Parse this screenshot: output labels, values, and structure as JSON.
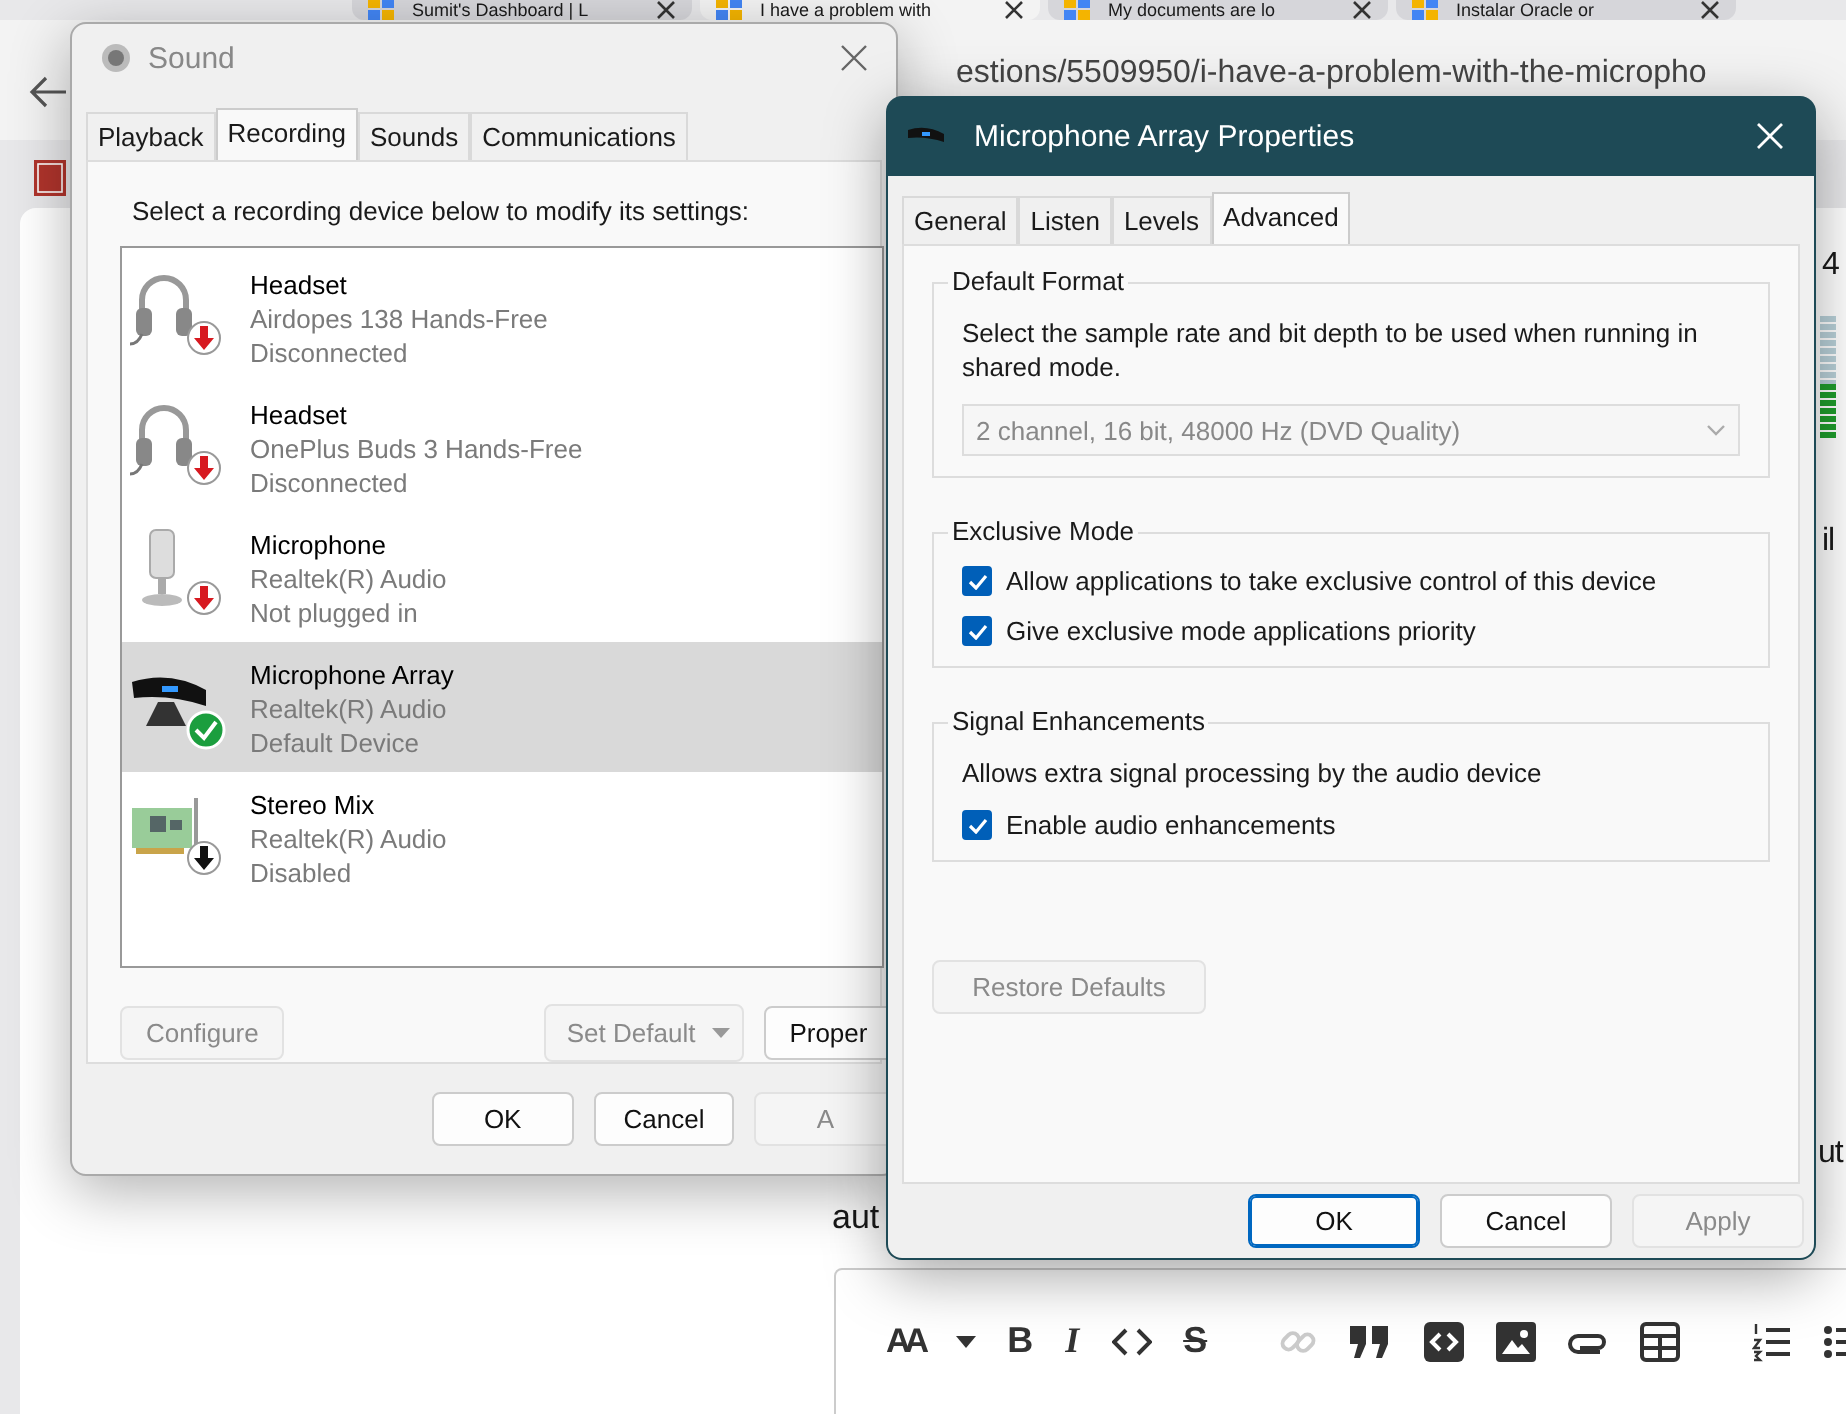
{
  "browser": {
    "tabs": [
      {
        "title": "Sumit's Dashboard | L",
        "selected": false
      },
      {
        "title": "I have a problem with",
        "selected": true
      },
      {
        "title": "My documents are lo",
        "selected": false
      },
      {
        "title": "Instalar Oracle or",
        "selected": false
      }
    ],
    "address": "estions/5509950/i-have-a-problem-with-the-micropho",
    "fragments": [
      "4",
      "il",
      "ut"
    ],
    "meter": {
      "level": 0.45
    },
    "body_text": "aut",
    "toolbar": [
      {
        "kind": "heading",
        "label": "AA",
        "disabled": false
      },
      {
        "kind": "caret",
        "disabled": false
      },
      {
        "kind": "bold",
        "label": "B",
        "disabled": false
      },
      {
        "kind": "italic",
        "label": "I",
        "disabled": false
      },
      {
        "kind": "code",
        "disabled": false
      },
      {
        "kind": "strike",
        "label": "S",
        "disabled": false
      },
      {
        "kind": "link",
        "disabled": true
      },
      {
        "kind": "quote",
        "disabled": false
      },
      {
        "kind": "codeblock",
        "disabled": false
      },
      {
        "kind": "image",
        "disabled": false
      },
      {
        "kind": "attach",
        "disabled": false
      },
      {
        "kind": "table",
        "disabled": false
      },
      {
        "kind": "ordered",
        "disabled": false
      },
      {
        "kind": "bullets",
        "disabled": false
      }
    ]
  },
  "sound_dialog": {
    "title": "Sound",
    "tabs": [
      {
        "label": "Playback",
        "selected": false
      },
      {
        "label": "Recording",
        "selected": true
      },
      {
        "label": "Sounds",
        "selected": false
      },
      {
        "label": "Communications",
        "selected": false
      }
    ],
    "instruction": "Select a recording device below to modify its settings:",
    "devices": [
      {
        "kind": "headset",
        "default": false,
        "color": "#d71920",
        "name": "Headset",
        "driver": "Airdopes 138 Hands-Free",
        "state": "Disconnected",
        "selected": false
      },
      {
        "kind": "headset",
        "default": false,
        "color": "#d71920",
        "name": "Headset",
        "driver": "OnePlus Buds 3 Hands-Free",
        "state": "Disconnected",
        "selected": false
      },
      {
        "kind": "microphone",
        "default": false,
        "color": "#d71920",
        "name": "Microphone",
        "driver": "Realtek(R) Audio",
        "state": "Not plugged in",
        "selected": false
      },
      {
        "kind": "array",
        "default": true,
        "color": "#1b9e3e",
        "name": "Microphone Array",
        "driver": "Realtek(R) Audio",
        "state": "Default Device",
        "selected": true
      },
      {
        "kind": "card",
        "default": false,
        "color": "#111111",
        "name": "Stereo Mix",
        "driver": "Realtek(R) Audio",
        "state": "Disabled",
        "selected": false
      }
    ],
    "configure": {
      "label": "Configure",
      "disabled": true
    },
    "set_default": {
      "label": "Set Default",
      "disabled": true
    },
    "properties": {
      "label": "Proper",
      "disabled": false
    },
    "buttons": [
      {
        "label": "OK",
        "disabled": false
      },
      {
        "label": "Cancel",
        "disabled": false
      },
      {
        "label": "A",
        "disabled": true
      }
    ]
  },
  "properties_dialog": {
    "title": "Microphone Array Properties",
    "tabs": [
      {
        "label": "General",
        "selected": false
      },
      {
        "label": "Listen",
        "selected": false
      },
      {
        "label": "Levels",
        "selected": false
      },
      {
        "label": "Advanced",
        "selected": true
      }
    ],
    "groups": [
      {
        "title": "Default Format",
        "description": "Select the sample rate and bit depth to be used when running in shared mode.",
        "dropdown": {
          "value": "2 channel, 16 bit, 48000 Hz (DVD Quality)",
          "disabled": true
        }
      },
      {
        "title": "Exclusive Mode",
        "options": [
          {
            "label": "Allow applications to take exclusive control of this device",
            "checked": true
          },
          {
            "label": "Give exclusive mode applications priority",
            "checked": true
          }
        ]
      },
      {
        "title": "Signal Enhancements",
        "description": "Allows extra signal processing by the audio device",
        "options": [
          {
            "label": "Enable audio enhancements",
            "checked": true
          }
        ]
      }
    ],
    "restore": {
      "label": "Restore Defaults",
      "disabled": true
    },
    "buttons": [
      {
        "label": "OK",
        "disabled": false,
        "focused": true
      },
      {
        "label": "Cancel",
        "disabled": false,
        "focused": false
      },
      {
        "label": "Apply",
        "disabled": true,
        "focused": false
      }
    ]
  }
}
